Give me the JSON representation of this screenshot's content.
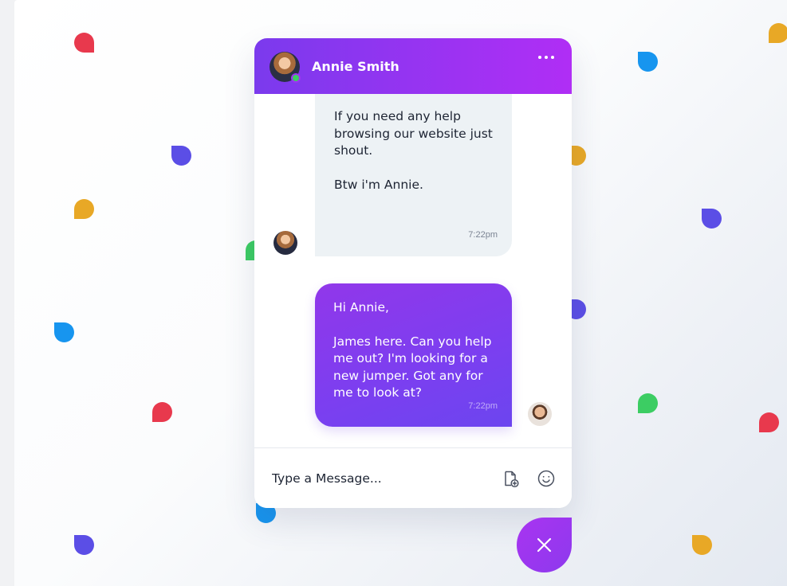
{
  "colors": {
    "header_gradient_start": "#7b3aed",
    "header_gradient_end": "#b02ef5",
    "outgoing_bubble": "#8b3cec",
    "incoming_bubble": "#edf2f5",
    "online_status": "#3ccd63",
    "confetti": [
      "#e8394d",
      "#e8a826",
      "#5b4ee6",
      "#1795ef",
      "#3ccd63"
    ]
  },
  "header": {
    "agent_name": "Annie Smith",
    "avatar_icon": "agent-avatar",
    "status_icon": "online-status-dot",
    "menu_icon": "more-options-icon"
  },
  "messages": [
    {
      "sender": "agent",
      "paragraphs": [
        "If you need any help\nbrowsing our website just\nshout.",
        "Btw i'm Annie."
      ],
      "time": "7:22pm"
    },
    {
      "sender": "user",
      "paragraphs": [
        "Hi Annie,",
        "James here. Can you help\nme out? I'm looking for a\nnew jumper. Got any for\nme to look at?"
      ],
      "time": "7:22pm"
    }
  ],
  "composer": {
    "placeholder": "Type a Message...",
    "value": "",
    "attach_icon": "attach-file-icon",
    "emoji_icon": "emoji-icon"
  },
  "launcher": {
    "icon": "close-icon"
  }
}
